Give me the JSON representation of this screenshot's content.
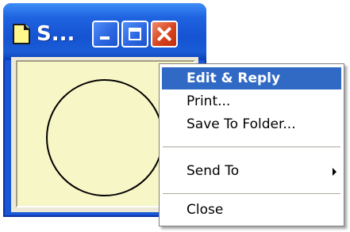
{
  "window": {
    "title": "S...",
    "controls": {
      "minimize": "minimize-icon",
      "maximize": "maximize-icon",
      "close": "close-icon"
    },
    "note_icon": "sticky-note-icon",
    "canvas_shape": "circle"
  },
  "context_menu": {
    "items": [
      {
        "label": "Edit & Reply",
        "highlighted": true
      },
      {
        "label": "Print..."
      },
      {
        "label": "Save To Folder..."
      },
      {
        "label": "Send To",
        "submenu_icon": "chevron-right-icon"
      },
      {
        "label": "Close"
      }
    ]
  },
  "colors": {
    "title_bar": "#1f63e0",
    "note_background": "#f7f6c6",
    "menu_highlight": "#316ac5",
    "close_button": "#d7431e"
  }
}
